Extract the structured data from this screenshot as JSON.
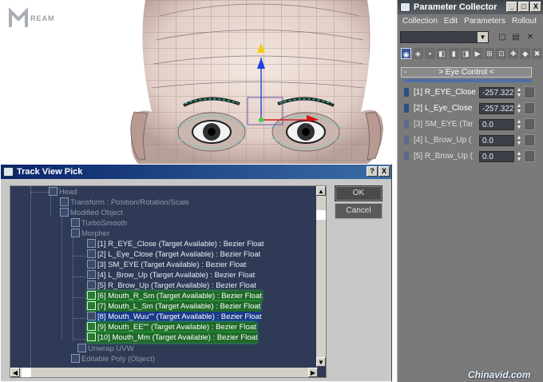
{
  "logo": {
    "text": "REAM"
  },
  "param_collector": {
    "title": "Parameter Collector",
    "window_buttons": [
      "_",
      "□",
      "X"
    ],
    "menu": [
      "Collection",
      "Edit",
      "Parameters",
      "Rollout"
    ],
    "rollout_title": "> Eye Control <",
    "rollout_collapse": "-",
    "params": [
      {
        "label": "[1] R_EYE_Close",
        "value": "-257.322",
        "selected": true
      },
      {
        "label": "[2] L_Eye_Close",
        "value": "-257.322",
        "selected": true
      },
      {
        "label": "[3] SM_EYE  (Tar",
        "value": "0.0",
        "selected": false
      },
      {
        "label": "[4] L_Brow_Up  (",
        "value": "0.0",
        "selected": false
      },
      {
        "label": "[5] R_Brow_Up  (",
        "value": "0.0",
        "selected": false
      }
    ]
  },
  "track_view_pick": {
    "title": "Track View Pick",
    "title_buttons": [
      "?",
      "X"
    ],
    "ok_label": "OK",
    "cancel_label": "Cancel",
    "tree": [
      {
        "text": "Head",
        "style": "dim"
      },
      {
        "text": "Transform : Position/Rotation/Scale",
        "style": "dim"
      },
      {
        "text": "Modified Object",
        "style": "dim"
      },
      {
        "text": "TurboSmooth",
        "style": "dim"
      },
      {
        "text": "Morpher",
        "style": "dim"
      },
      {
        "text": "[1] R_EYE_Close (Target Available) : Bezier Float",
        "style": "light"
      },
      {
        "text": "[2] L_Eye_Close (Target Available) : Bezier Float",
        "style": "light"
      },
      {
        "text": "[3] SM_EYE  (Target Available) : Bezier Float",
        "style": "light"
      },
      {
        "text": "[4] L_Brow_Up  (Target Available) : Bezier Float",
        "style": "light"
      },
      {
        "text": "[5] R_Brow_Up  (Target Available) : Bezier Float",
        "style": "light"
      },
      {
        "text": "[6] Mouth_R_Sm  (Target Available) : Bezier Float",
        "style": "green"
      },
      {
        "text": "[7] Mouth_L_Sm  (Target Available) : Bezier Float",
        "style": "green"
      },
      {
        "text": "[8] Mouth_Wuu\"\"  (Target Available) : Bezier Float",
        "style": "sel"
      },
      {
        "text": "[9] Mouth_EE\"\"  (Target Available) : Bezier Float",
        "style": "green"
      },
      {
        "text": "[10] Mouth_Mm  (Target Available) : Bezier Float",
        "style": "green"
      },
      {
        "text": "Unwrap UVW",
        "style": "dim"
      },
      {
        "text": "Editable Poly (Object)",
        "style": "dim"
      }
    ]
  },
  "watermark": "Chinavid.com",
  "colors": {
    "panel": "#7a7a7a",
    "tree_bg": "#2f3b56",
    "highlight_green": "#1f6a28",
    "title_blue": "#0a246a"
  }
}
